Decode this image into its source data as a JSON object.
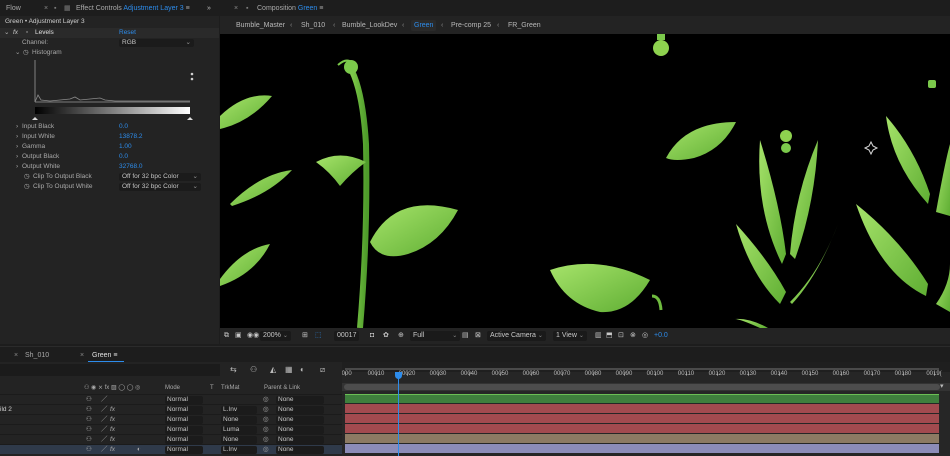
{
  "top_tabs": {
    "flow": "Flow",
    "effect_controls_prefix": "Effect Controls",
    "effect_controls_layer": "Adjustment Layer 3",
    "composition_prefix": "Composition",
    "composition_name": "Green"
  },
  "breadcrumbs": [
    "Bumble_Master",
    "Sh_010",
    "Bumble_LookDev",
    "Green",
    "Pre-comp 25",
    "FR_Green"
  ],
  "breadcrumb_active": "Green",
  "effect_controls": {
    "subtitle": "Green • Adjustment Layer 3",
    "effect_name": "Levels",
    "reset_label": "Reset",
    "channel_label": "Channel:",
    "channel_value": "RGB",
    "histogram_label": "Histogram",
    "params": [
      {
        "label": "Input Black",
        "value": "0.0"
      },
      {
        "label": "Input White",
        "value": "13878.2"
      },
      {
        "label": "Gamma",
        "value": "1.00"
      },
      {
        "label": "Output Black",
        "value": "0.0"
      },
      {
        "label": "Output White",
        "value": "32768.0"
      }
    ],
    "clip_black_label": "Clip To Output Black",
    "clip_black_value": "Off for 32 bpc Color",
    "clip_white_label": "Clip To Output White",
    "clip_white_value": "Off for 32 bpc Color"
  },
  "viewer_bar": {
    "zoom": "200%",
    "timecode": "00017",
    "resolution": "Full",
    "camera": "Active Camera",
    "views": "1 View",
    "exposure": "+0.0"
  },
  "timeline": {
    "tabs": [
      "Sh_010",
      "Green"
    ],
    "active_tab": "Green",
    "headers": {
      "mode": "Mode",
      "t": "T",
      "trkmat": "TrkMat",
      "parent": "Parent & Link"
    },
    "ruler_labels": [
      "0000",
      "00010",
      "00020",
      "00030",
      "00040",
      "00050",
      "00060",
      "00070",
      "00080",
      "00090",
      "00100",
      "00110",
      "00120",
      "00130",
      "00140",
      "00150",
      "00160",
      "00170",
      "00180",
      "0019("
    ],
    "playhead_frame": 17,
    "layers": [
      {
        "name": "",
        "mode": "Normal",
        "trkmat": "",
        "parent": "None",
        "color": "#3f7f3d"
      },
      {
        "name": "ild 2",
        "mode": "Normal",
        "trkmat": "L.Inv",
        "parent": "None",
        "color": "#a24a4f"
      },
      {
        "name": "",
        "mode": "Normal",
        "trkmat": "None",
        "parent": "None",
        "color": "#a24a4f"
      },
      {
        "name": "",
        "mode": "Normal",
        "trkmat": "Luma",
        "parent": "None",
        "color": "#a24a4f"
      },
      {
        "name": "",
        "mode": "Normal",
        "trkmat": "None",
        "parent": "None",
        "color": "#8c7a63"
      },
      {
        "name": "",
        "mode": "Normal",
        "trkmat": "L.Inv",
        "parent": "None",
        "color": "#8c8cb8"
      }
    ]
  },
  "colors": {
    "accent": "#2d8ceb",
    "panel": "#232323",
    "leaf_green": "#8ed24f"
  }
}
